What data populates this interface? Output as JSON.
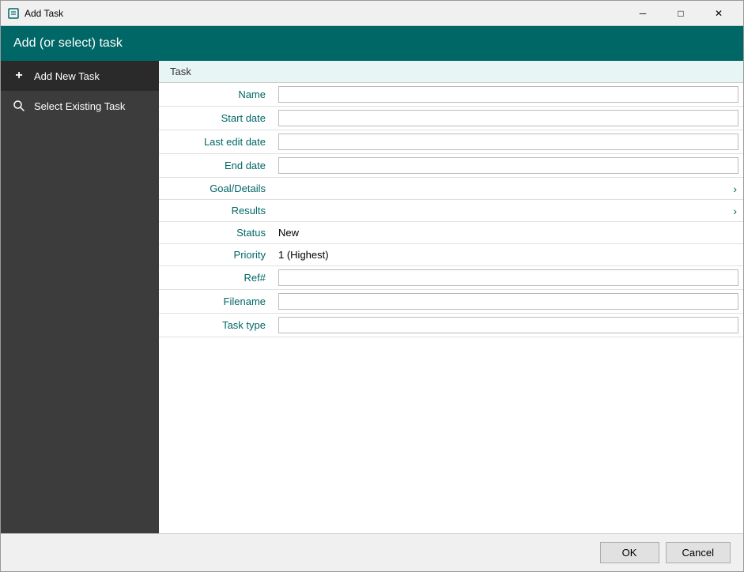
{
  "window": {
    "title": "Add Task",
    "icon": "task-icon"
  },
  "header": {
    "title": "Add (or select) task"
  },
  "sidebar": {
    "items": [
      {
        "id": "add-new-task",
        "label": "Add New Task",
        "icon": "+",
        "active": true
      },
      {
        "id": "select-existing-task",
        "label": "Select Existing Task",
        "icon": "🔍",
        "active": false
      }
    ]
  },
  "content": {
    "header_label": "Task",
    "fields": [
      {
        "label": "Name",
        "type": "input",
        "value": "",
        "placeholder": ""
      },
      {
        "label": "Start date",
        "type": "input",
        "value": "",
        "placeholder": ""
      },
      {
        "label": "Last edit date",
        "type": "input",
        "value": "",
        "placeholder": ""
      },
      {
        "label": "End date",
        "type": "input",
        "value": "",
        "placeholder": ""
      },
      {
        "label": "Goal/Details",
        "type": "expandable",
        "value": ""
      },
      {
        "label": "Results",
        "type": "expandable",
        "value": ""
      },
      {
        "label": "Status",
        "type": "text",
        "value": "New"
      },
      {
        "label": "Priority",
        "type": "text",
        "value": "1 (Highest)"
      },
      {
        "label": "Ref#",
        "type": "input",
        "value": "",
        "placeholder": ""
      },
      {
        "label": "Filename",
        "type": "input",
        "value": "",
        "placeholder": ""
      },
      {
        "label": "Task type",
        "type": "input",
        "value": "",
        "placeholder": ""
      }
    ]
  },
  "buttons": {
    "ok_label": "OK",
    "cancel_label": "Cancel"
  },
  "titlebar_controls": {
    "minimize": "─",
    "maximize": "□",
    "close": "✕"
  }
}
